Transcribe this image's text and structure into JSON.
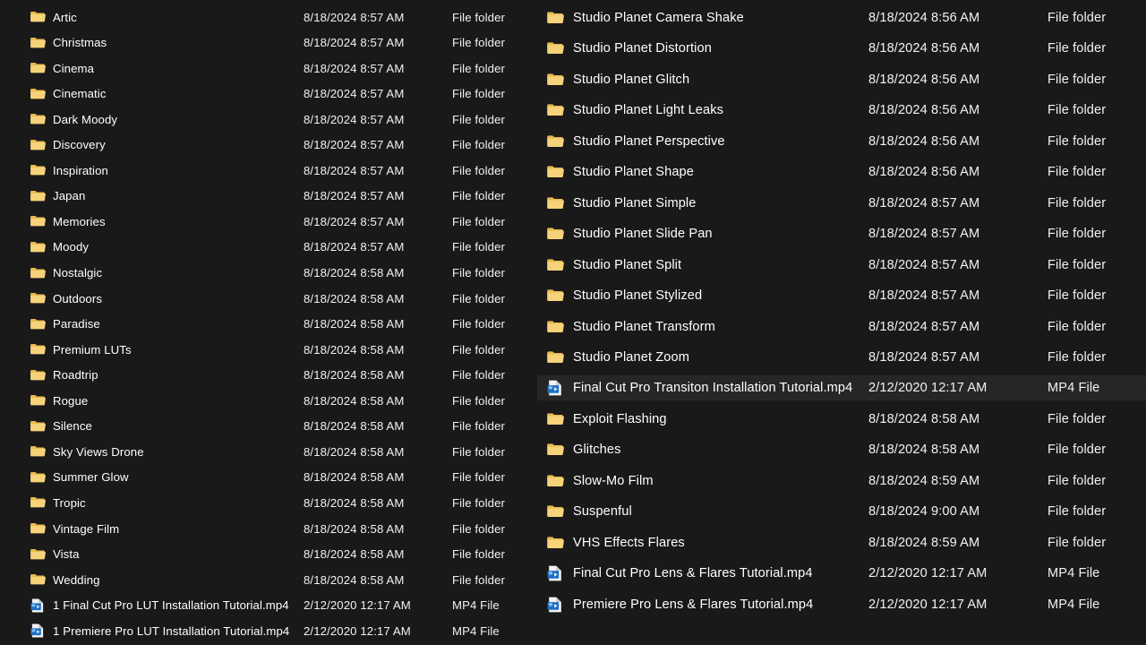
{
  "window": {
    "background_color": "#191919",
    "text_color": "#ffffff",
    "selected_row_color": "#262626",
    "folder_icon_color": "#f7d278",
    "mp4_icon_color": "#2b7cd3"
  },
  "panes": [
    {
      "id": "left-pane",
      "rows": [
        {
          "icon": "folder-icon",
          "name": "Artic",
          "date": "8/18/2024 8:57 AM",
          "type": "File folder",
          "selected": false
        },
        {
          "icon": "folder-icon",
          "name": "Christmas",
          "date": "8/18/2024 8:57 AM",
          "type": "File folder",
          "selected": false
        },
        {
          "icon": "folder-icon",
          "name": "Cinema",
          "date": "8/18/2024 8:57 AM",
          "type": "File folder",
          "selected": false
        },
        {
          "icon": "folder-icon",
          "name": "Cinematic",
          "date": "8/18/2024 8:57 AM",
          "type": "File folder",
          "selected": false
        },
        {
          "icon": "folder-icon",
          "name": "Dark Moody",
          "date": "8/18/2024 8:57 AM",
          "type": "File folder",
          "selected": false
        },
        {
          "icon": "folder-icon",
          "name": "Discovery",
          "date": "8/18/2024 8:57 AM",
          "type": "File folder",
          "selected": false
        },
        {
          "icon": "folder-icon",
          "name": "Inspiration",
          "date": "8/18/2024 8:57 AM",
          "type": "File folder",
          "selected": false
        },
        {
          "icon": "folder-icon",
          "name": "Japan",
          "date": "8/18/2024 8:57 AM",
          "type": "File folder",
          "selected": false
        },
        {
          "icon": "folder-icon",
          "name": "Memories",
          "date": "8/18/2024 8:57 AM",
          "type": "File folder",
          "selected": false
        },
        {
          "icon": "folder-icon",
          "name": "Moody",
          "date": "8/18/2024 8:57 AM",
          "type": "File folder",
          "selected": false
        },
        {
          "icon": "folder-icon",
          "name": "Nostalgic",
          "date": "8/18/2024 8:58 AM",
          "type": "File folder",
          "selected": false
        },
        {
          "icon": "folder-icon",
          "name": "Outdoors",
          "date": "8/18/2024 8:58 AM",
          "type": "File folder",
          "selected": false
        },
        {
          "icon": "folder-icon",
          "name": "Paradise",
          "date": "8/18/2024 8:58 AM",
          "type": "File folder",
          "selected": false
        },
        {
          "icon": "folder-icon",
          "name": "Premium LUTs",
          "date": "8/18/2024 8:58 AM",
          "type": "File folder",
          "selected": false
        },
        {
          "icon": "folder-icon",
          "name": "Roadtrip",
          "date": "8/18/2024 8:58 AM",
          "type": "File folder",
          "selected": false
        },
        {
          "icon": "folder-icon",
          "name": "Rogue",
          "date": "8/18/2024 8:58 AM",
          "type": "File folder",
          "selected": false
        },
        {
          "icon": "folder-icon",
          "name": "Silence",
          "date": "8/18/2024 8:58 AM",
          "type": "File folder",
          "selected": false
        },
        {
          "icon": "folder-icon",
          "name": "Sky Views Drone",
          "date": "8/18/2024 8:58 AM",
          "type": "File folder",
          "selected": false
        },
        {
          "icon": "folder-icon",
          "name": "Summer Glow",
          "date": "8/18/2024 8:58 AM",
          "type": "File folder",
          "selected": false
        },
        {
          "icon": "folder-icon",
          "name": "Tropic",
          "date": "8/18/2024 8:58 AM",
          "type": "File folder",
          "selected": false
        },
        {
          "icon": "folder-icon",
          "name": "Vintage Film",
          "date": "8/18/2024 8:58 AM",
          "type": "File folder",
          "selected": false
        },
        {
          "icon": "folder-icon",
          "name": "Vista",
          "date": "8/18/2024 8:58 AM",
          "type": "File folder",
          "selected": false
        },
        {
          "icon": "folder-icon",
          "name": "Wedding",
          "date": "8/18/2024 8:58 AM",
          "type": "File folder",
          "selected": false
        },
        {
          "icon": "mp4-file-icon",
          "name": "1 Final Cut Pro LUT Installation Tutorial.mp4",
          "date": "2/12/2020 12:17 AM",
          "type": "MP4 File",
          "selected": false
        },
        {
          "icon": "mp4-file-icon",
          "name": "1 Premiere Pro LUT Installation Tutorial.mp4",
          "date": "2/12/2020 12:17 AM",
          "type": "MP4 File",
          "selected": false
        }
      ]
    },
    {
      "id": "right-pane",
      "rows": [
        {
          "icon": "folder-icon",
          "name": "Studio Planet Camera Shake",
          "date": "8/18/2024 8:56 AM",
          "type": "File folder",
          "selected": false
        },
        {
          "icon": "folder-icon",
          "name": "Studio Planet Distortion",
          "date": "8/18/2024 8:56 AM",
          "type": "File folder",
          "selected": false
        },
        {
          "icon": "folder-icon",
          "name": "Studio Planet Glitch",
          "date": "8/18/2024 8:56 AM",
          "type": "File folder",
          "selected": false
        },
        {
          "icon": "folder-icon",
          "name": "Studio Planet Light Leaks",
          "date": "8/18/2024 8:56 AM",
          "type": "File folder",
          "selected": false
        },
        {
          "icon": "folder-icon",
          "name": "Studio Planet Perspective",
          "date": "8/18/2024 8:56 AM",
          "type": "File folder",
          "selected": false
        },
        {
          "icon": "folder-icon",
          "name": "Studio Planet Shape",
          "date": "8/18/2024 8:56 AM",
          "type": "File folder",
          "selected": false
        },
        {
          "icon": "folder-icon",
          "name": "Studio Planet Simple",
          "date": "8/18/2024 8:57 AM",
          "type": "File folder",
          "selected": false
        },
        {
          "icon": "folder-icon",
          "name": "Studio Planet Slide Pan",
          "date": "8/18/2024 8:57 AM",
          "type": "File folder",
          "selected": false
        },
        {
          "icon": "folder-icon",
          "name": "Studio Planet Split",
          "date": "8/18/2024 8:57 AM",
          "type": "File folder",
          "selected": false
        },
        {
          "icon": "folder-icon",
          "name": "Studio Planet Stylized",
          "date": "8/18/2024 8:57 AM",
          "type": "File folder",
          "selected": false
        },
        {
          "icon": "folder-icon",
          "name": "Studio Planet Transform",
          "date": "8/18/2024 8:57 AM",
          "type": "File folder",
          "selected": false
        },
        {
          "icon": "folder-icon",
          "name": "Studio Planet Zoom",
          "date": "8/18/2024 8:57 AM",
          "type": "File folder",
          "selected": false
        },
        {
          "icon": "mp4-file-icon",
          "name": "Final Cut Pro Transiton Installation Tutorial.mp4",
          "date": "2/12/2020 12:17 AM",
          "type": "MP4 File",
          "selected": true
        },
        {
          "icon": "folder-icon",
          "name": "Exploit Flashing",
          "date": "8/18/2024 8:58 AM",
          "type": "File folder",
          "selected": false
        },
        {
          "icon": "folder-icon",
          "name": "Glitches",
          "date": "8/18/2024 8:58 AM",
          "type": "File folder",
          "selected": false
        },
        {
          "icon": "folder-icon",
          "name": "Slow-Mo Film",
          "date": "8/18/2024 8:59 AM",
          "type": "File folder",
          "selected": false
        },
        {
          "icon": "folder-icon",
          "name": "Suspenful",
          "date": "8/18/2024 9:00 AM",
          "type": "File folder",
          "selected": false
        },
        {
          "icon": "folder-icon",
          "name": "VHS Effects Flares",
          "date": "8/18/2024 8:59 AM",
          "type": "File folder",
          "selected": false
        },
        {
          "icon": "mp4-file-icon",
          "name": "Final Cut Pro Lens & Flares Tutorial.mp4",
          "date": "2/12/2020 12:17 AM",
          "type": "MP4 File",
          "selected": false
        },
        {
          "icon": "mp4-file-icon",
          "name": "Premiere Pro Lens & Flares Tutorial.mp4",
          "date": "2/12/2020 12:17 AM",
          "type": "MP4 File",
          "selected": false
        }
      ]
    }
  ]
}
